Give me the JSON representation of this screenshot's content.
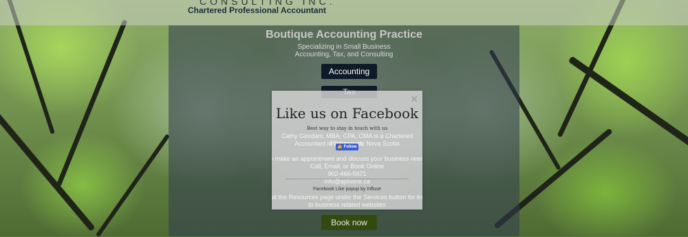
{
  "header": {
    "company": "CONSULTING INC.",
    "tagline": "Chartered Professional Accountant"
  },
  "panel": {
    "title": "Boutique Accounting Practice",
    "sub1": "Specializing in Small Business",
    "sub2": "Accounting, Tax, and Consulting",
    "buttons": {
      "accounting": "Accounting",
      "tax": "Tax",
      "book": "Book now"
    }
  },
  "popup": {
    "close": "✕",
    "title": "Like us on Facebook",
    "best": "Best way to stay in touch with us",
    "follow": "Follow",
    "bg_line1": "Cathy Giordani, MBA, CPA, CMA is a Chartered Professional",
    "bg_line2": "Accountant in Dartmouth, Nova Scotia",
    "bg_line3": "To make an appointment and discuss your business needs",
    "bg_line4": "Call, Email, or Book Online",
    "bg_phone": "902-466-5671",
    "bg_email": "info@aplusns.ca",
    "powered_link": "Facebook Like popup",
    "powered_by": "by Influse",
    "bg_line5": "Visit the Resources page under the Services button for links",
    "bg_line6": "to business related websites"
  },
  "colors": {
    "dark_button": "#0e1a28",
    "green_button": "#334a0f",
    "facebook": "#3b5ed0"
  }
}
